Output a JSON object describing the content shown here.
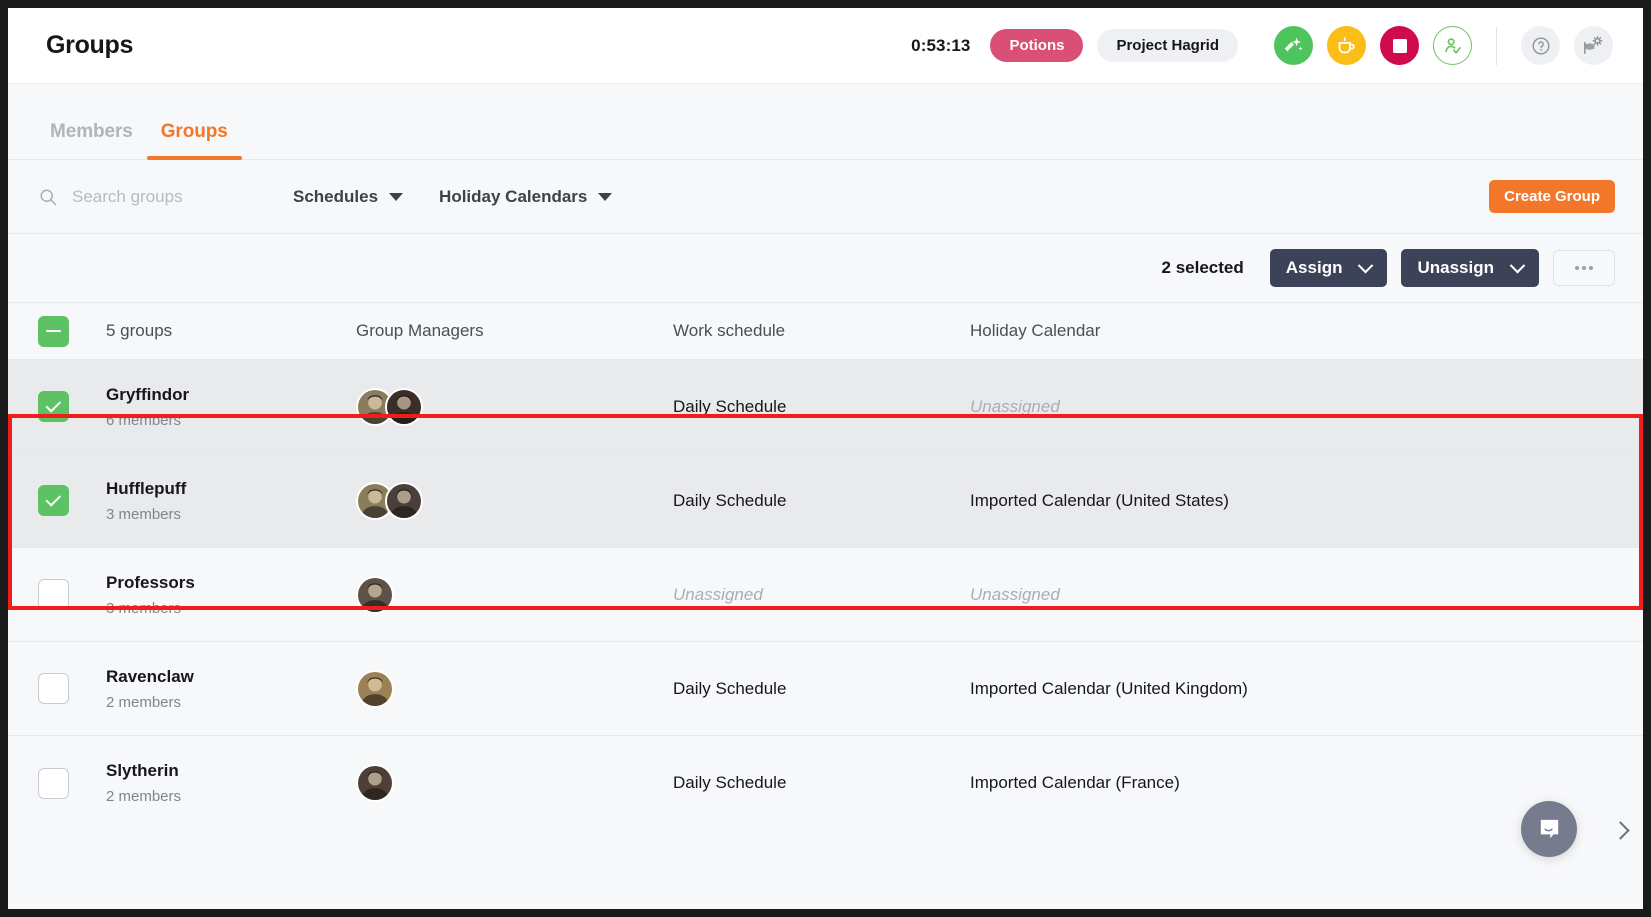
{
  "header": {
    "title": "Groups",
    "timer": "0:53:13",
    "task_pill": "Potions",
    "project_pill": "Project Hagrid",
    "icons": {
      "switch_task": "switch-task-icon",
      "break": "coffee-break-icon",
      "stop": "stop-timer-icon",
      "attendance": "attendance-icon",
      "help": "help-icon",
      "settings": "settings-flag-icon"
    },
    "colors": {
      "task_pill_bg": "#d94f76",
      "project_pill_bg": "#eef0f3",
      "switch_task_bg": "#4ec45c",
      "break_bg": "#fbbd18",
      "stop_bg": "#cf0a4d",
      "attendance_border": "#6fc25b"
    }
  },
  "tabs": [
    {
      "label": "Members",
      "active": false
    },
    {
      "label": "Groups",
      "active": true
    }
  ],
  "filters": {
    "search_placeholder": "Search groups",
    "search_value": "",
    "schedules_label": "Schedules",
    "holiday_calendars_label": "Holiday Calendars",
    "create_group_label": "Create Group",
    "accent_color": "#f3772b"
  },
  "actionbar": {
    "selected_text": "2 selected",
    "assign_label": "Assign",
    "unassign_label": "Unassign",
    "more_label": "•••",
    "button_color": "#3c4257"
  },
  "table": {
    "headers": {
      "count": "5 groups",
      "managers": "Group Managers",
      "work_schedule": "Work schedule",
      "holiday_calendar": "Holiday Calendar"
    },
    "select_all_state": "indeterminate",
    "rows": [
      {
        "name": "Gryffindor",
        "members": "6 members",
        "checked": true,
        "managers": 2,
        "avatar_colors": [
          "#8a7d5e",
          "#3a2f28"
        ],
        "work_schedule": "Daily Schedule",
        "work_schedule_unassigned": false,
        "holiday_calendar": "Unassigned",
        "holiday_calendar_unassigned": true
      },
      {
        "name": "Hufflepuff",
        "members": "3 members",
        "checked": true,
        "managers": 2,
        "avatar_colors": [
          "#8a7d5e",
          "#4a3f3a"
        ],
        "work_schedule": "Daily Schedule",
        "work_schedule_unassigned": false,
        "holiday_calendar": "Imported Calendar (United States)",
        "holiday_calendar_unassigned": false
      },
      {
        "name": "Professors",
        "members": "3 members",
        "checked": false,
        "managers": 1,
        "avatar_colors": [
          "#5c5247"
        ],
        "work_schedule": "Unassigned",
        "work_schedule_unassigned": true,
        "holiday_calendar": "Unassigned",
        "holiday_calendar_unassigned": true
      },
      {
        "name": "Ravenclaw",
        "members": "2 members",
        "checked": false,
        "managers": 1,
        "avatar_colors": [
          "#9a8255"
        ],
        "work_schedule": "Daily Schedule",
        "work_schedule_unassigned": false,
        "holiday_calendar": "Imported Calendar (United Kingdom)",
        "holiday_calendar_unassigned": false
      },
      {
        "name": "Slytherin",
        "members": "2 members",
        "checked": false,
        "managers": 1,
        "avatar_colors": [
          "#4e4038"
        ],
        "work_schedule": "Daily Schedule",
        "work_schedule_unassigned": false,
        "holiday_calendar": "Imported Calendar (France)",
        "holiday_calendar_unassigned": false
      }
    ]
  },
  "annotation": {
    "highlight_color": "#f01d1d",
    "highlight_rows": [
      0,
      1
    ]
  },
  "chat": {
    "widget_icon": "chat-bubble-icon",
    "widget_color": "#767c8e",
    "edge_icon": "chevron-right-icon"
  }
}
